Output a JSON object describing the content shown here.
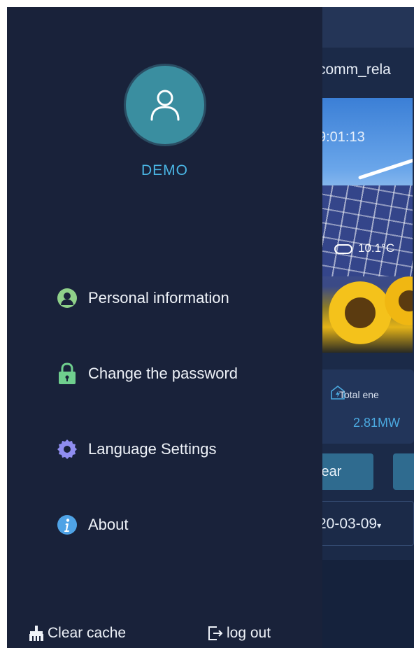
{
  "background_app": {
    "title": "comm_rela",
    "time": "9:01:13",
    "temperature": "10.1°C",
    "card": {
      "label": "Total ene",
      "value": "2.81MW"
    },
    "period_button": "Year",
    "date_value": "20-03-09"
  },
  "drawer": {
    "user": {
      "name": "DEMO",
      "avatar_icon": "user-icon"
    },
    "menu": [
      {
        "label": "Personal information",
        "icon": "person-icon",
        "color": "#8fd18a"
      },
      {
        "label": "Change the password",
        "icon": "lock-icon",
        "color": "#6fcf8e"
      },
      {
        "label": "Language Settings",
        "icon": "gear-icon",
        "color": "#8f8df0"
      },
      {
        "label": "About",
        "icon": "info-icon",
        "color": "#4fa3e6"
      }
    ],
    "footer": {
      "clear_cache": "Clear cache",
      "log_out": "log out"
    }
  },
  "colors": {
    "drawer_bg": "#19223a",
    "accent": "#4ab5e3",
    "text": "#eef2f8"
  }
}
